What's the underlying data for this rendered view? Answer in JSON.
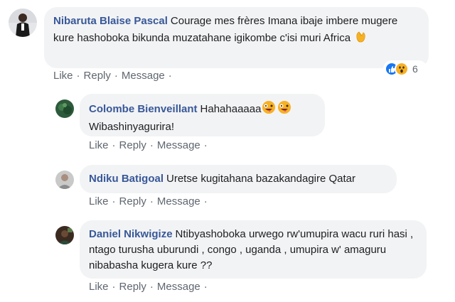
{
  "comments": [
    {
      "author": "Nibaruta Blaise Pascal",
      "text": "Courage mes frères Imana ibaje imbere mugere kure hashoboka bikunda muzatahane igikombe c'isi muri Africa",
      "emoji": "clapping-hands",
      "actions": [
        "Like",
        "Reply",
        "Message"
      ],
      "reaction_count": "6",
      "reactions": [
        "like",
        "wow"
      ]
    },
    {
      "author": "Colombe Bienveillant",
      "text": "Hahahaaaaa",
      "text2": "Wibashinyagurira!",
      "emoji": "zany-face",
      "actions": [
        "Like",
        "Reply",
        "Message"
      ]
    },
    {
      "author": "Ndiku Batigoal",
      "text": "Uretse kugitahana bazakandagire Qatar",
      "actions": [
        "Like",
        "Reply",
        "Message"
      ]
    },
    {
      "author": "Daniel Nikwigize",
      "text": "Ntibyashoboka urwego rw'umupira wacu ruri hasi , ntago turusha uburundi , congo , uganda , umupira w' amaguru nibabasha kugera kure ??",
      "actions": [
        "Like",
        "Reply",
        "Message"
      ]
    }
  ],
  "colors": {
    "author": "#385898",
    "bubble": "#f2f3f5",
    "action": "#606770",
    "like": "#1877f2",
    "wow": "#f7b125"
  }
}
